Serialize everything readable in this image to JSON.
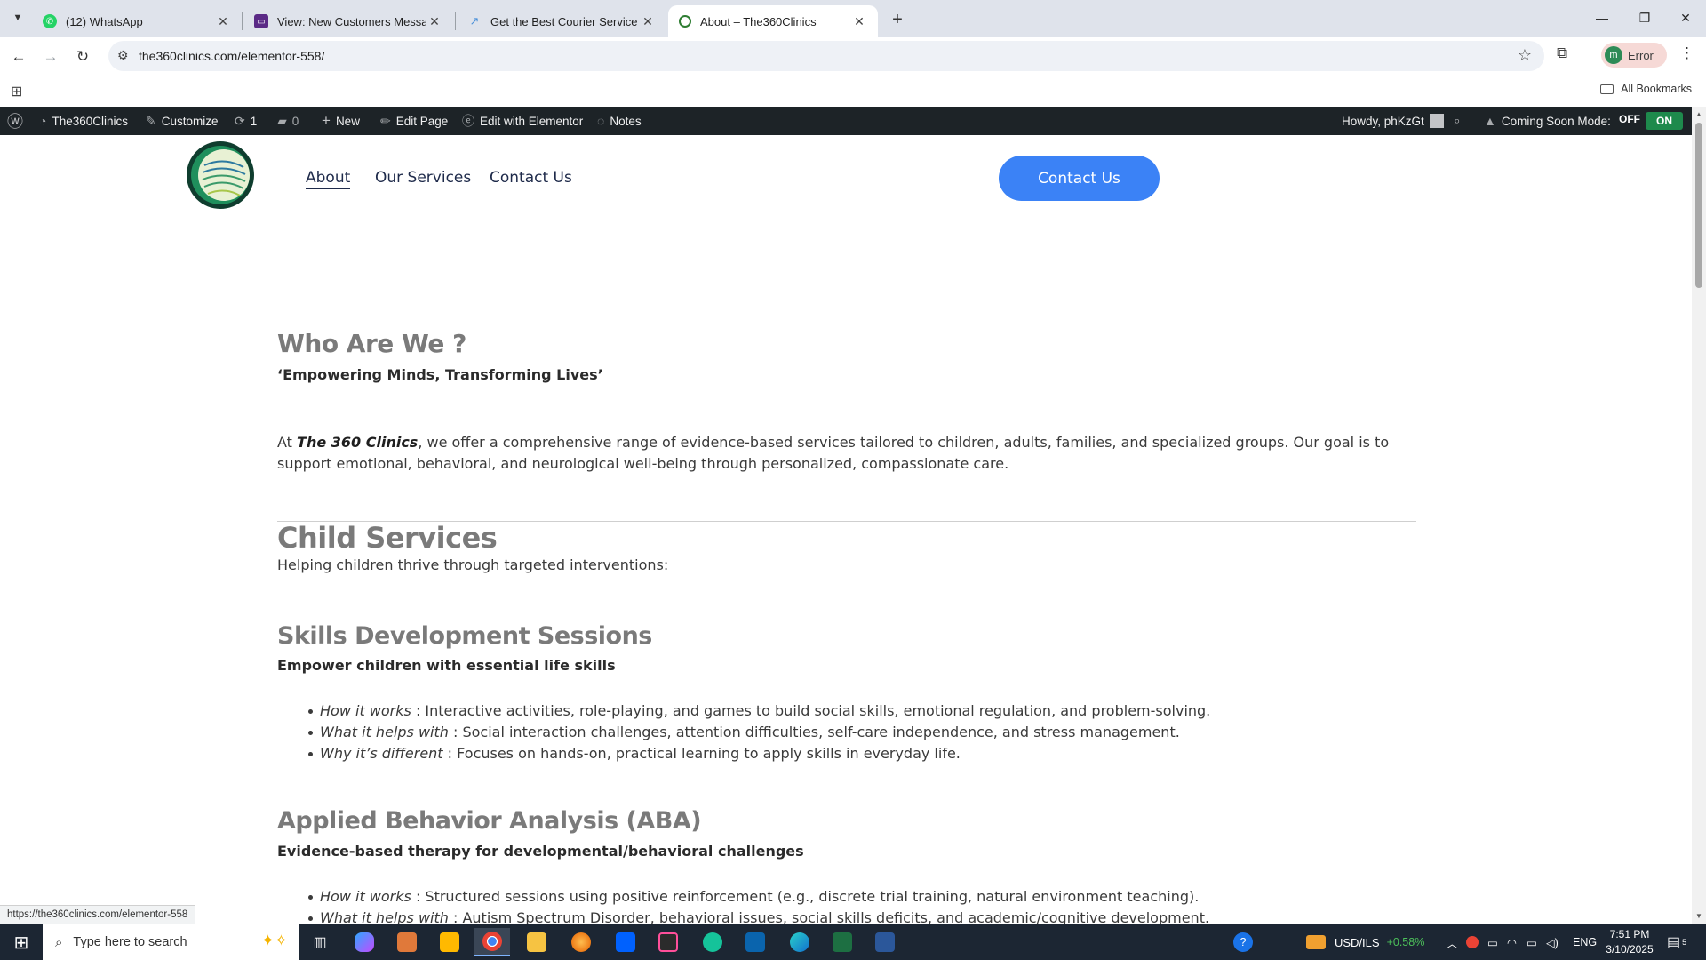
{
  "browser": {
    "tabs": [
      {
        "title": "(12) WhatsApp",
        "icon": "whatsapp-icon",
        "color": "#25d366"
      },
      {
        "title": "View: New Customers Message",
        "icon": "form-icon",
        "color": "#5b2a86"
      },
      {
        "title": "Get the Best Courier Service in",
        "icon": "courier-icon",
        "color": "#4a90d9"
      },
      {
        "title": "About – The360Clinics",
        "icon": "loading-icon",
        "color": "#2e7d32"
      }
    ],
    "url": "the360clinics.com/elementor-558/",
    "profile_label": "Error",
    "profile_initial": "m",
    "all_bookmarks": "All Bookmarks",
    "status_url": "https://the360clinics.com/elementor-558"
  },
  "wp_admin": {
    "site_name": "The360Clinics",
    "customize": "Customize",
    "updates_count": "1",
    "comments_count": "0",
    "new_label": "New",
    "edit_page": "Edit Page",
    "edit_elementor": "Edit with Elementor",
    "notes": "Notes",
    "howdy": "Howdy, phKzGt",
    "coming_soon": "Coming Soon Mode:",
    "off": "OFF",
    "on": "ON"
  },
  "site_nav": {
    "links": [
      "About",
      "Our Services",
      "Contact Us"
    ],
    "cta": "Contact Us"
  },
  "content": {
    "who_title": "Who Are We ?",
    "who_tagline": "‘Empowering Minds, Transforming Lives’",
    "intro_at": "At ",
    "intro_brand": "The 360 Clinics",
    "intro_rest": ", we offer a comprehensive range of evidence-based services tailored to children, adults, families, and specialized groups. Our goal is to support emotional, behavioral, and neurological well-being through personalized, compassionate care.",
    "child_title": "Child Services",
    "child_sub": "Helping children thrive through targeted interventions:",
    "skills_title": "Skills Development Sessions",
    "skills_tag": "Empower children with essential life skills",
    "skills_items": [
      {
        "k": "How it works",
        "v": " : Interactive activities, role-playing, and games to build social skills, emotional regulation, and problem-solving."
      },
      {
        "k": "What it helps with",
        "v": " : Social interaction challenges, attention difficulties, self-care independence, and stress management."
      },
      {
        "k": "Why it’s different",
        "v": " : Focuses on hands-on, practical learning to apply skills in everyday life."
      }
    ],
    "aba_title": "Applied Behavior Analysis (ABA)",
    "aba_tag": "Evidence-based therapy for developmental/behavioral challenges",
    "aba_items": [
      {
        "k": "How it works",
        "v": " : Structured sessions using positive reinforcement (e.g., discrete trial training, natural environment teaching)."
      },
      {
        "k": "What it helps with",
        "v": " : Autism Spectrum Disorder, behavioral issues, social skills deficits, and academic/cognitive development."
      }
    ]
  },
  "taskbar": {
    "search_placeholder": "Type here to search",
    "ticker": "USD/ILS",
    "ticker_change": "+0.58%",
    "lang": "ENG",
    "time": "7:51 PM",
    "date": "3/10/2025",
    "notif_count": "5"
  }
}
